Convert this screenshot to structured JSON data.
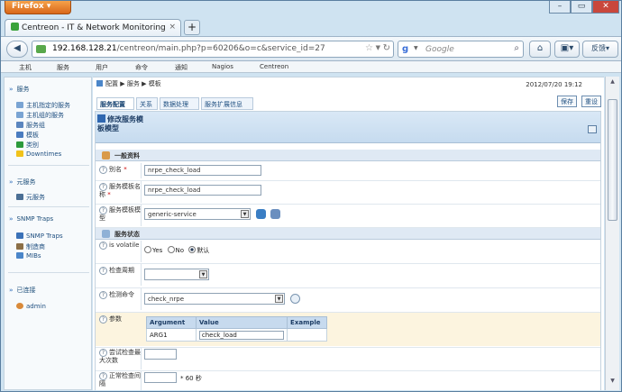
{
  "browser": {
    "name": "Firefox",
    "window_controls": [
      "–",
      "▭",
      "✕"
    ]
  },
  "tab": {
    "title": "Centreon - IT & Network Monitoring",
    "close": "×",
    "new_tab": "+"
  },
  "address": {
    "host": "192.168.128.21",
    "path": "/centreon/main.php?p=60206&o=c&service_id=27",
    "search_placeholder": "Google",
    "search_logo": "g",
    "feedback": "反馈"
  },
  "menu": [
    "主机",
    "服务",
    "用户",
    "命令",
    "通知",
    "Nagios",
    "Centreon"
  ],
  "sidebar": {
    "sections": [
      {
        "title": "服务",
        "items": [
          "主机指定的服务",
          "主机组的服务",
          "服务组",
          "模板",
          "类别",
          "Downtimes"
        ]
      },
      {
        "title": "元服务",
        "items": [
          "元服务"
        ]
      },
      {
        "title": "SNMP Traps",
        "items": [
          "SNMP Traps",
          "制造商",
          "MIBs"
        ]
      },
      {
        "title": "已连接",
        "items": [
          "admin"
        ]
      }
    ]
  },
  "breadcrumb": [
    "配置",
    "服务",
    "模板"
  ],
  "datetime": "2012/07/20 19:12",
  "tabs": [
    "服务配置",
    "关系",
    "数据处理",
    "服务扩展信息"
  ],
  "buttons": {
    "save": "保存",
    "reset": "重设"
  },
  "form": {
    "title": "修改服务模板模型",
    "section_general": "一般资料",
    "alias_label": "别名",
    "alias_value": "nrpe_check_load",
    "req": "*",
    "template_name_label": "服务模板名称",
    "template_name_value": "nrpe_check_load",
    "template_model_label": "服务模板模型",
    "template_model_value": "generic-service",
    "section_state": "服务状态",
    "volatile_label": "is volatile",
    "volatile_options": [
      "Yes",
      "No",
      "默认"
    ],
    "check_period_label": "检查周期",
    "check_period_value": "",
    "check_command_label": "检测命令",
    "check_command_value": "check_nrpe",
    "args_label": "参数",
    "args_headers": [
      "Argument",
      "Value",
      "Example"
    ],
    "args_rows": [
      {
        "argument": "ARG1",
        "value": "check_load",
        "example": ""
      }
    ],
    "max_attempts_label": "尝试检查最大次数",
    "max_attempts_value": "",
    "normal_interval_label": "正常检查间隔",
    "normal_interval_value": "",
    "normal_interval_unit": "* 60 秒"
  },
  "colors": {
    "header_bg": "#c6dbef",
    "accent": "#2f67b0",
    "title": "#1e3e66"
  }
}
